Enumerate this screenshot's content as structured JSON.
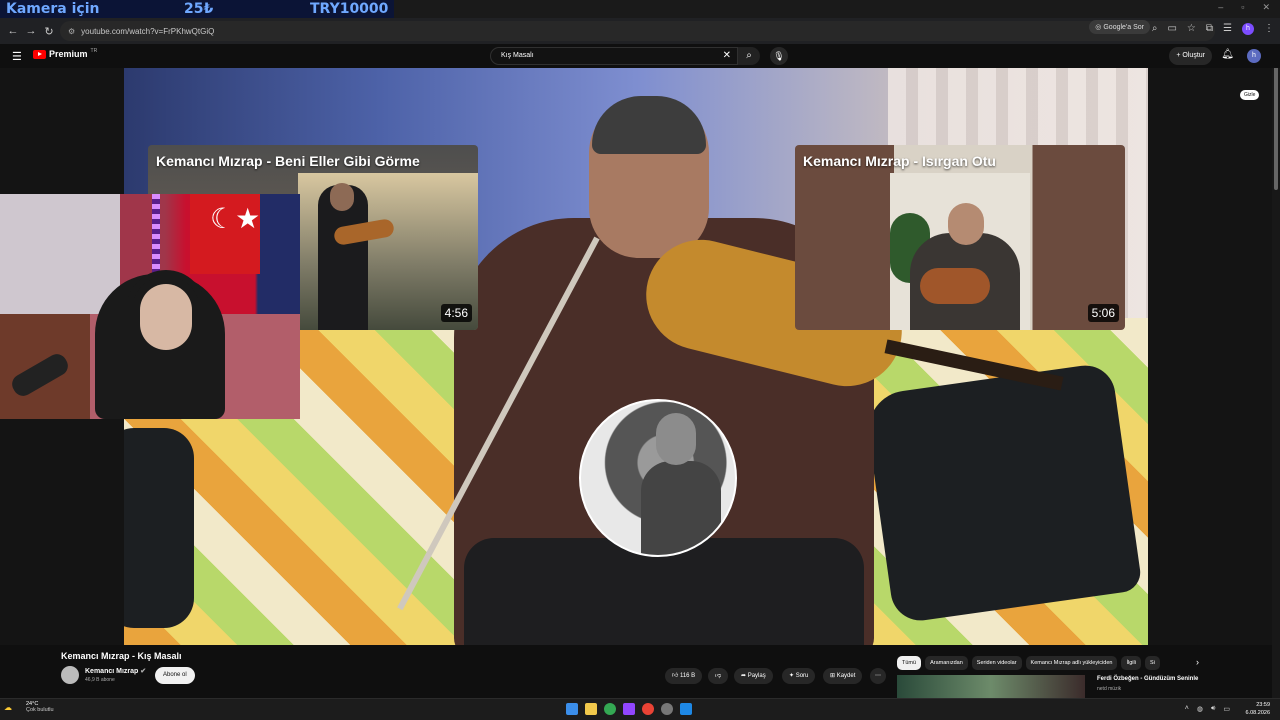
{
  "overlay": {
    "donation_label": "Kamera için",
    "donation_price": "25₺",
    "donation_target": "TRY10000"
  },
  "browser": {
    "url": "youtube.com/watch?v=FrPKhwQtGiQ",
    "google_lens_label": "Google'a Sor",
    "profile_initial": "h"
  },
  "youtube": {
    "brand": "Premium",
    "country_code": "TR",
    "search_value": "Kış Masalı",
    "create_label": "+ Oluştur",
    "user_initial": "h"
  },
  "endscreen": {
    "left_card": {
      "title": "Kemancı Mızrap - Beni Eller Gibi Görme",
      "duration": "4:56"
    },
    "right_card": {
      "title": "Kemancı Mızrap - Isırgan Otu",
      "duration": "5:06"
    }
  },
  "filter_chip": "Gizle",
  "video_info": {
    "title": "Kemancı Mızrap - Kış Masalı",
    "channel": "Kemancı Mızrap",
    "subscribers": "46,9 B abone",
    "subscribe_label": "Abone ol",
    "likes": "116 B",
    "share_label": "Paylaş",
    "ask_label": "Soru",
    "save_label": "Kaydet"
  },
  "related_chips": [
    "Tümü",
    "Aramanızdan",
    "Seriden videolar",
    "Kemancı Mızrap adlı yükleyiciden",
    "İlgili",
    "Si"
  ],
  "recommended": {
    "title": "Ferdi Özbeğen - Gündüzüm Seninle",
    "channel": "netd müzik"
  },
  "taskbar": {
    "temperature": "24°C",
    "condition": "Çok bulutlu",
    "time": "23:59",
    "date": "6.08.2026"
  },
  "colors": {
    "accent": "#ff0000",
    "donation_text": "#6fa8ff",
    "background": "#0f0f0f"
  }
}
